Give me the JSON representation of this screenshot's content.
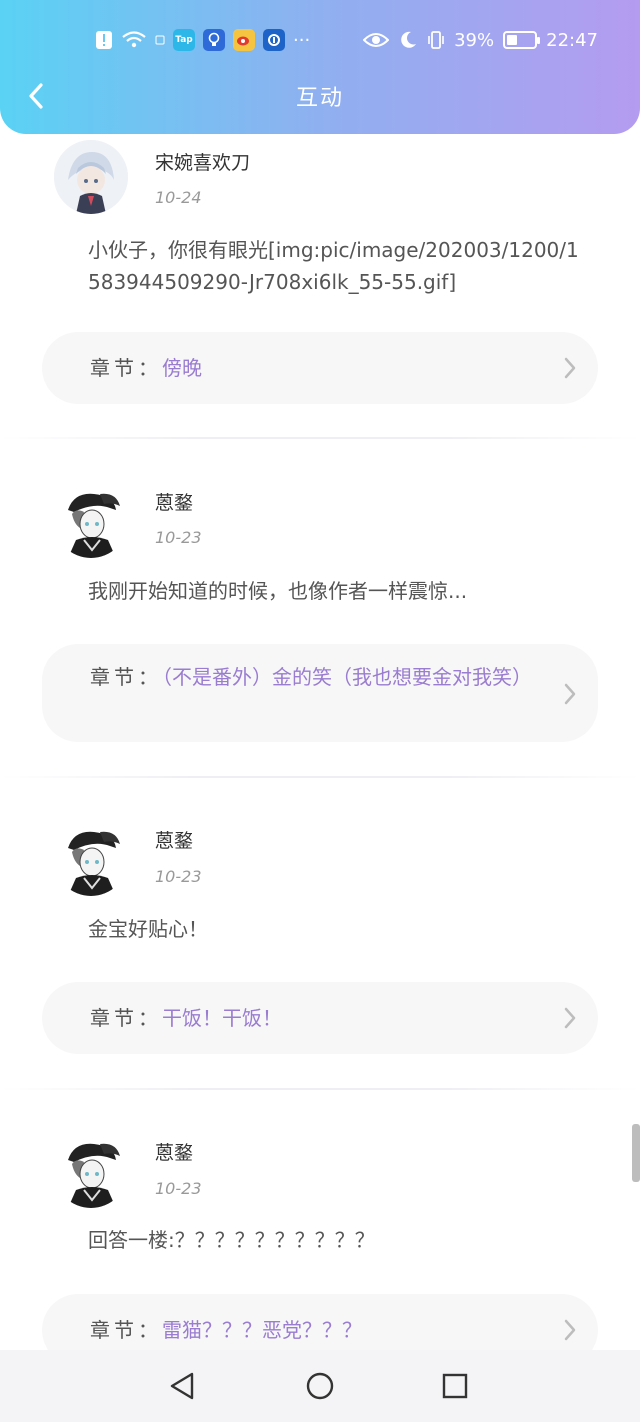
{
  "status_bar": {
    "time": "22:47",
    "battery_percent": "39%",
    "battery_level": 0.39,
    "left_icons": [
      "alert-icon",
      "wifi-icon",
      "tap-app-icon",
      "bulb-app-icon",
      "weibo-app-icon",
      "bank-app-icon",
      "more-dots-icon"
    ],
    "tap_label": "Tap",
    "more": "···"
  },
  "header": {
    "title": "互动",
    "gradient_start": "#5ad2f4",
    "gradient_end": "#b49cf0"
  },
  "comments": [
    {
      "user": "宋婉喜欢刀",
      "date": "10-24",
      "content": "小伙子，你很有眼光[img:pic/image/202003/1200/1583944509290-Jr708xi6lk_55-55.gif]",
      "chapter_label": "章节：",
      "chapter_title": "傍晚"
    },
    {
      "user": "蒽鍪",
      "date": "10-23",
      "content": "我刚开始知道的时候，也像作者一样震惊...",
      "chapter_label": "章节：",
      "chapter_title": "（不是番外）金的笑（我也想要金对我笑）"
    },
    {
      "user": "蒽鍪",
      "date": "10-23",
      "content": "金宝好贴心！",
      "chapter_label": "章节：",
      "chapter_title": "干饭！干饭！"
    },
    {
      "user": "蒽鍪",
      "date": "10-23",
      "content": "回答一楼:？？？？？？？？？？",
      "chapter_label": "章节：",
      "chapter_title": "雷猫？？？恶党？？？"
    }
  ],
  "accent_color": "#9a7cd0",
  "nav_bar": {
    "buttons": [
      "back-triangle-icon",
      "home-circle-icon",
      "recents-square-icon"
    ]
  }
}
